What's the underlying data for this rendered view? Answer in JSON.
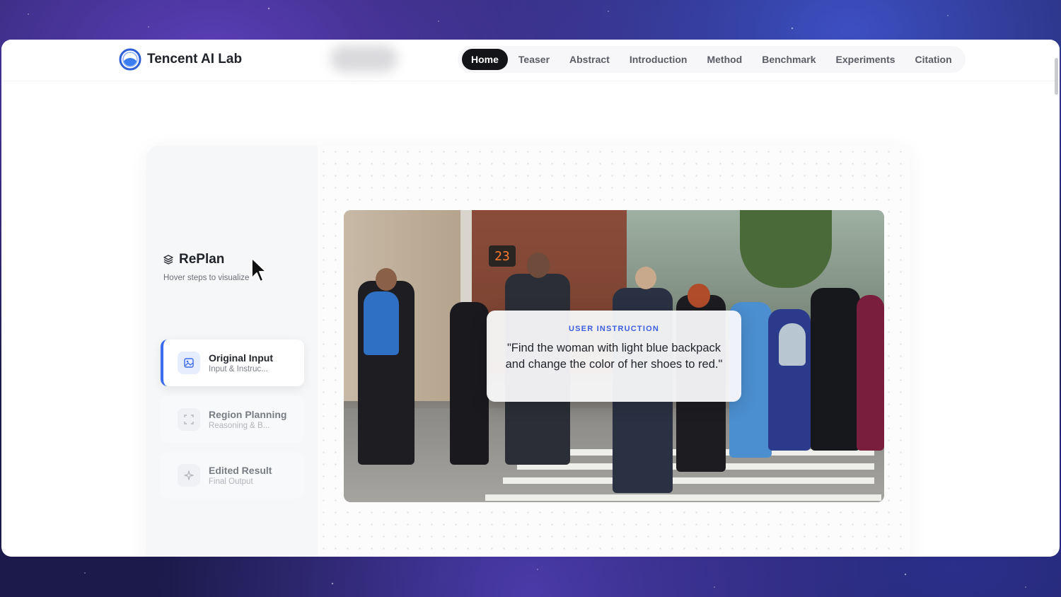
{
  "navbar": {
    "brand": "Tencent AI Lab",
    "items": [
      {
        "label": "Home",
        "active": true
      },
      {
        "label": "Teaser"
      },
      {
        "label": "Abstract"
      },
      {
        "label": "Introduction"
      },
      {
        "label": "Method"
      },
      {
        "label": "Benchmark"
      },
      {
        "label": "Experiments"
      },
      {
        "label": "Citation"
      }
    ]
  },
  "sidebar": {
    "title": "RePlan",
    "icon": "layers-icon",
    "subtitle": "Hover steps to visualize",
    "steps": [
      {
        "title": "Original Input",
        "subtitle": "Input & Instruc...",
        "icon": "image-icon",
        "active": true
      },
      {
        "title": "Region Planning",
        "subtitle": "Reasoning & B...",
        "icon": "region-icon",
        "active": false
      },
      {
        "title": "Edited Result",
        "subtitle": "Final Output",
        "icon": "sparkle-icon",
        "active": false
      }
    ]
  },
  "preview": {
    "signal_number": "23",
    "instruction_label": "USER INSTRUCTION",
    "instruction_text": "\"Find the woman with light blue backpack and change the color of her shoes to red.\""
  },
  "colors": {
    "accent": "#3b6cf0",
    "nav_active_bg": "#121418",
    "instruction_label": "#3b5fe0"
  }
}
